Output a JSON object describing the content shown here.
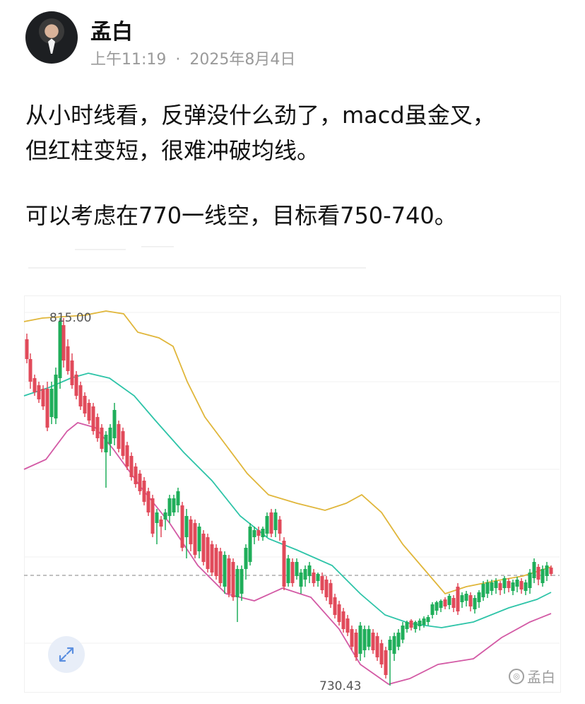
{
  "author": {
    "name": "孟白"
  },
  "meta": {
    "time": "上午11:19",
    "separator": "·",
    "date": "2025年8月4日"
  },
  "post": {
    "line1": "从小时线看，反弹没什么劲了，macd虽金叉，",
    "line2": "但红柱变短，很难冲破均线。",
    "line3": "可以考虑在770一线空，目标看750-740。"
  },
  "chart": {
    "high_label": "815.00",
    "low_label": "730.43",
    "watermark_text": "孟白",
    "colors": {
      "up": "#1fae5a",
      "down": "#e14a5a",
      "upper_band": "#e0b63a",
      "middle_band": "#2ec4a8",
      "lower_band": "#d35aa5",
      "dashed": "#9a9a9a"
    }
  },
  "icons": {
    "expand": "expand-icon",
    "watermark": "watermark-logo-icon"
  }
}
